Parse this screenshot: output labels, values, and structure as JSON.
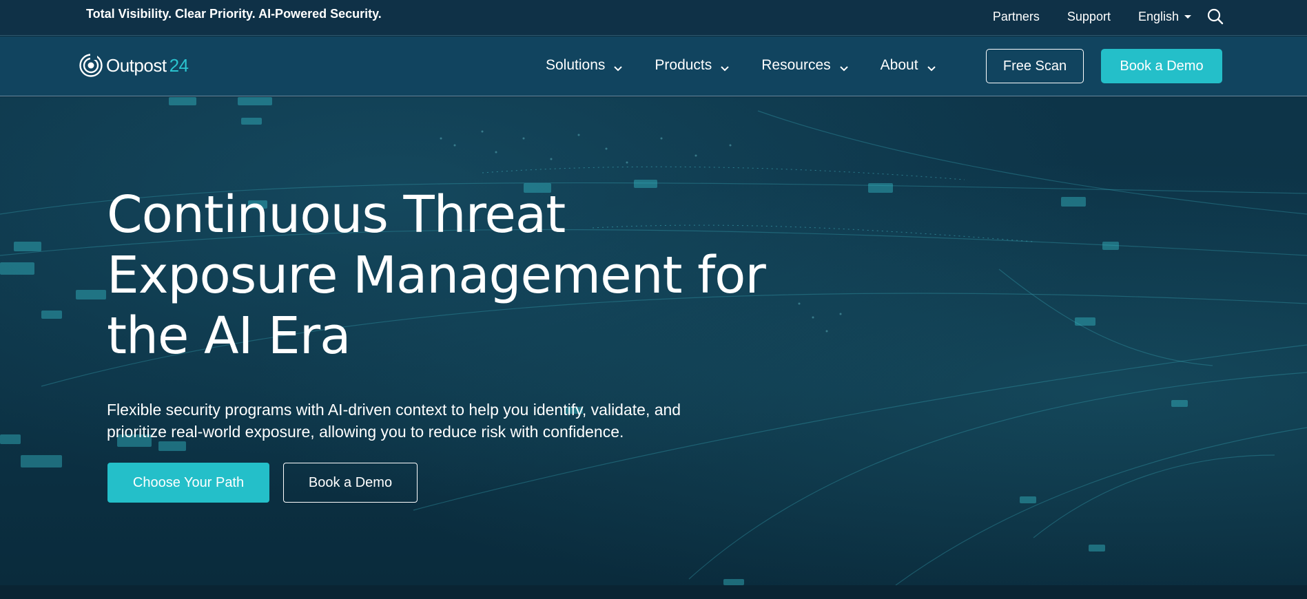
{
  "topbar": {
    "tagline": "Total Visibility. Clear Priority. AI-Powered Security.",
    "links": [
      "Partners",
      "Support"
    ],
    "language": "English",
    "icons": {
      "language_caret": "caret-down-icon",
      "search": "search-icon"
    }
  },
  "navbar": {
    "logo": {
      "name_main": "Outpost",
      "name_accent": "24",
      "icon": "outpost24-logo-icon"
    },
    "items": [
      {
        "label": "Solutions"
      },
      {
        "label": "Products"
      },
      {
        "label": "Resources"
      },
      {
        "label": "About"
      }
    ],
    "free_scan_label": "Free Scan",
    "book_demo_label": "Book a Demo"
  },
  "hero": {
    "title_line1": "Continuous Threat",
    "title_line2": "Exposure Management for",
    "title_line3": "the AI Era",
    "subtitle_line1": "Flexible security programs with AI-driven context to help you identify, validate, and",
    "subtitle_line2": "prioritize real-world exposure, allowing you to reduce risk with confidence.",
    "primary_cta": "Choose Your Path",
    "secondary_cta": "Book a Demo"
  },
  "colors": {
    "accent": "#24bfc9",
    "topbar_bg": "#0f3147",
    "navbar_bg": "#11445f",
    "hero_bg": "#0c3245"
  }
}
